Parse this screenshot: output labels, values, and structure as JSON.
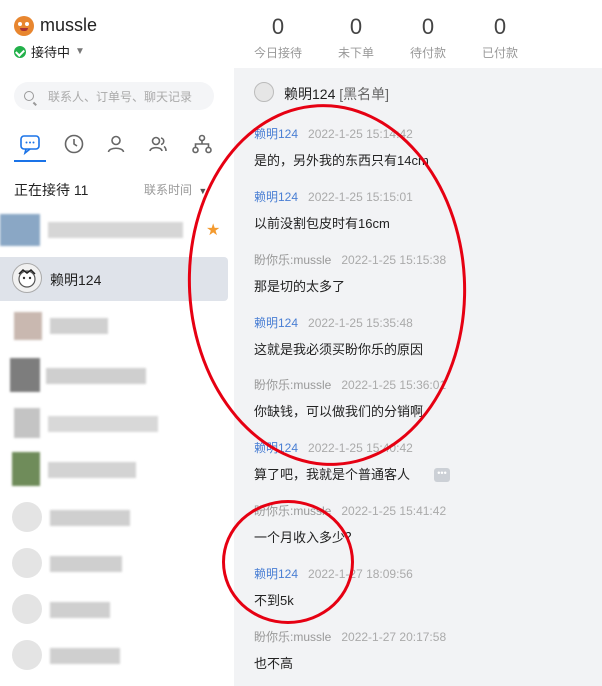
{
  "brand": {
    "name": "mussle",
    "status": "接待中"
  },
  "stats": [
    {
      "value": "0",
      "label": "今日接待"
    },
    {
      "value": "0",
      "label": "未下单"
    },
    {
      "value": "0",
      "label": "待付款"
    },
    {
      "value": "0",
      "label": "已付款"
    }
  ],
  "search": {
    "placeholder": "联系人、订单号、聊天记录"
  },
  "sidebar": {
    "section_title": "正在接待 11",
    "sort_label": "联系时间",
    "active_contact": "赖明124"
  },
  "chat": {
    "title": "赖明124",
    "tag": "[黑名单]",
    "messages": [
      {
        "sender": "赖明124",
        "time": "2022-1-25 15:14:42",
        "text": "是的，另外我的东西只有14cm",
        "role": "customer"
      },
      {
        "sender": "赖明124",
        "time": "2022-1-25 15:15:01",
        "text": "以前没割包皮时有16cm",
        "role": "customer"
      },
      {
        "sender": "盼你乐:mussle",
        "time": "2022-1-25 15:15:38",
        "text": "那是切的太多了",
        "role": "agent"
      },
      {
        "sender": "赖明124",
        "time": "2022-1-25 15:35:48",
        "text": "这就是我必须买盼你乐的原因",
        "role": "customer"
      },
      {
        "sender": "盼你乐:mussle",
        "time": "2022-1-25 15:36:01",
        "text": "你缺钱，可以做我们的分销啊",
        "role": "agent"
      },
      {
        "sender": "赖明124",
        "time": "2022-1-25 15:40:42",
        "text": "算了吧，我就是个普通客人",
        "role": "customer"
      },
      {
        "sender": "盼你乐:mussle",
        "time": "2022-1-25 15:41:42",
        "text": "一个月收入多少？",
        "role": "agent"
      },
      {
        "sender": "赖明124",
        "time": "2022-1-27 18:09:56",
        "text": "不到5k",
        "role": "customer"
      },
      {
        "sender": "盼你乐:mussle",
        "time": "2022-1-27 20:17:58",
        "text": "也不高",
        "role": "agent"
      }
    ]
  },
  "colors": {
    "accent": "#1a73e8",
    "customer_name": "#4a7fd4",
    "annotation": "#e60012",
    "online": "#22b04a"
  }
}
